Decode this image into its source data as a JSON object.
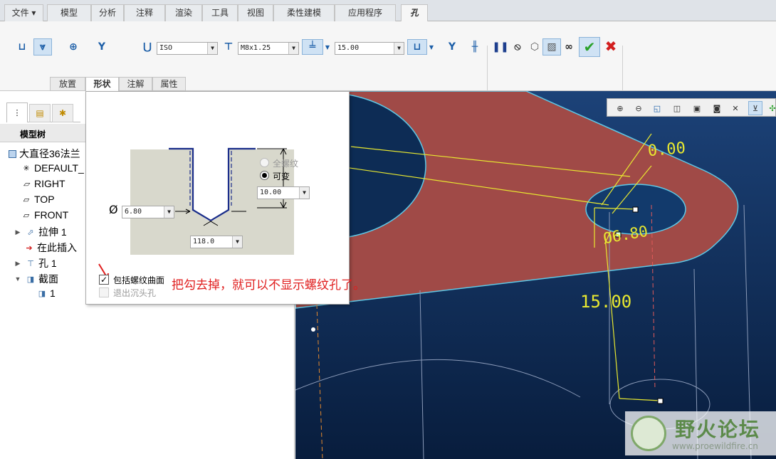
{
  "menu": {
    "file": "文件",
    "tabs": [
      "模型",
      "分析",
      "注释",
      "渲染",
      "工具",
      "视图",
      "柔性建模",
      "应用程序"
    ],
    "active_tab": "孔"
  },
  "ribbon": {
    "standard": "ISO",
    "screw_size": "M8x1.25",
    "depth": "15.00",
    "subtabs": [
      "放置",
      "形状",
      "注解",
      "属性"
    ],
    "active_subtab": "形状"
  },
  "shape_panel": {
    "radio_full": "全螺纹",
    "radio_variable": "可变",
    "thread_depth": "10.00",
    "diameter_symbol": "Ø",
    "diameter": "6.80",
    "angle": "118.0",
    "checkbox_thread_surface": "包括螺纹曲面",
    "checkbox_countersink": "退出沉头孔"
  },
  "annotation": "把勾去掉，就可以不显示螺纹孔了。",
  "tree": {
    "tabs": [
      "model-tree-tab",
      "layer-tab",
      "favorites-tab"
    ],
    "header": "模型树",
    "items": [
      {
        "label": "大直径36法兰",
        "icon": "part-icon"
      },
      {
        "label": "DEFAULT_",
        "icon": "csys-icon"
      },
      {
        "label": "RIGHT",
        "icon": "datum-plane-icon"
      },
      {
        "label": "TOP",
        "icon": "datum-plane-icon"
      },
      {
        "label": "FRONT",
        "icon": "datum-plane-icon"
      },
      {
        "label": "拉伸 1",
        "icon": "extrude-icon"
      },
      {
        "label": "在此插入",
        "icon": "insert-arrow-icon"
      },
      {
        "label": "孔 1",
        "icon": "hole-icon"
      },
      {
        "label": "截面",
        "icon": "section-icon"
      },
      {
        "label": "1",
        "icon": "section-icon"
      }
    ]
  },
  "viewport": {
    "dim_top": "0.00",
    "dim_diameter": "Ø6.80",
    "dim_depth": "15.00"
  },
  "watermark": {
    "title": "野火论坛",
    "url": "www.proewildfire.cn"
  },
  "colors": {
    "part_surface": "#a04a47",
    "background": "#0d2c55",
    "dimension": "#e8e830",
    "accept": "#2aa12a",
    "cancel": "#d21e1e"
  }
}
